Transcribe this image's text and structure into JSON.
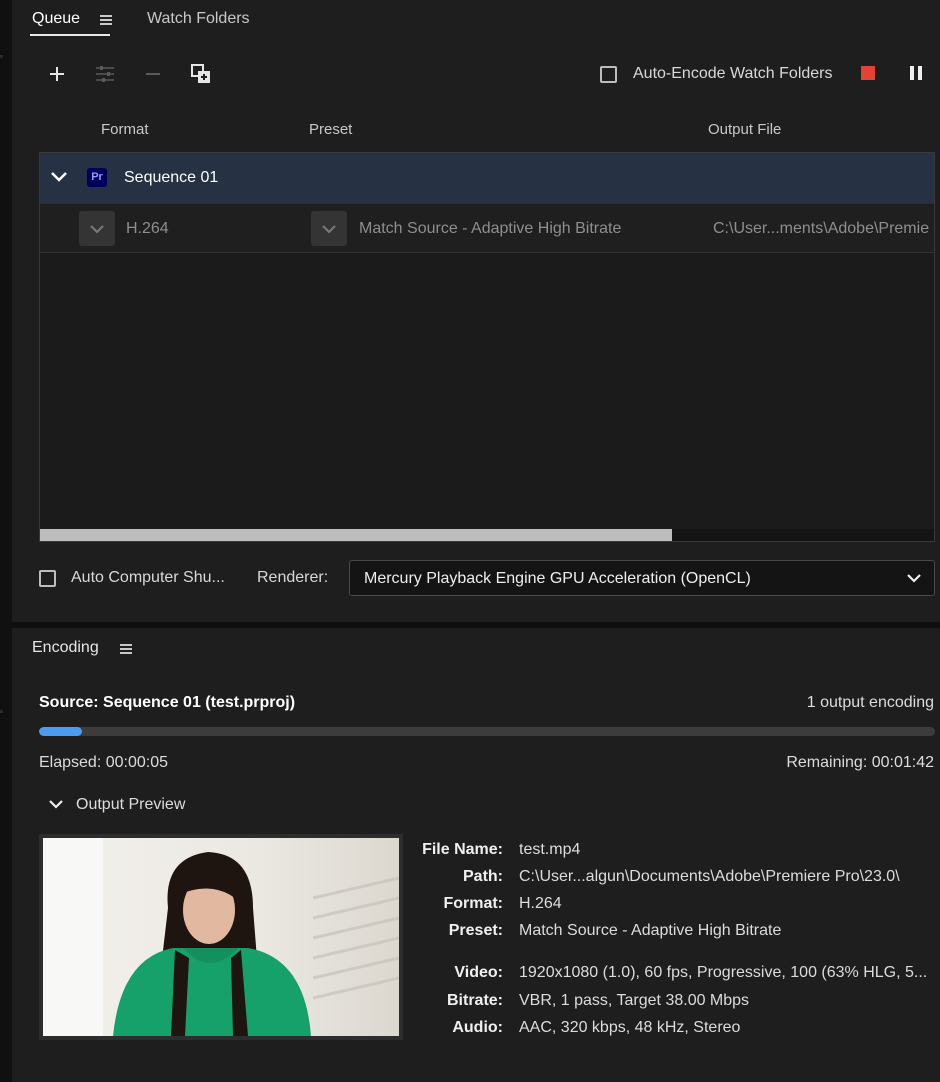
{
  "tabs": {
    "queue": "Queue",
    "watch_folders": "Watch Folders"
  },
  "toolbar": {
    "auto_encode_label": "Auto-Encode Watch Folders",
    "auto_encode_checked": false,
    "stop_color": "#e34234"
  },
  "columns": {
    "format": "Format",
    "preset": "Preset",
    "output": "Output File"
  },
  "queue": {
    "sequence_name": "Sequence 01",
    "app_badge": "Pr",
    "output": {
      "format": "H.264",
      "preset": "Match Source - Adaptive High Bitrate",
      "output_file": "C:\\User...ments\\Adobe\\Premie"
    }
  },
  "bottom_bar": {
    "auto_shutdown_label": "Auto Computer Shu...",
    "renderer_label": "Renderer:",
    "renderer_value": "Mercury Playback Engine GPU Acceleration (OpenCL)"
  },
  "encoding": {
    "title": "Encoding",
    "source": "Source: Sequence 01 (test.prproj)",
    "count": "1 output encoding",
    "progress_percent": 4.8,
    "elapsed": "Elapsed: 00:00:05",
    "remaining": "Remaining: 00:01:42",
    "preview_label": "Output Preview"
  },
  "info": [
    {
      "key": "File Name:",
      "value": "test.mp4"
    },
    {
      "key": "Path:",
      "value": "C:\\User...algun\\Documents\\Adobe\\Premiere Pro\\23.0\\"
    },
    {
      "key": "Format:",
      "value": "H.264"
    },
    {
      "key": "Preset:",
      "value": "Match Source - Adaptive High Bitrate"
    },
    {
      "key": "Video:",
      "value": "1920x1080 (1.0), 60 fps, Progressive, 100 (63% HLG, 5..."
    },
    {
      "key": "Bitrate:",
      "value": "VBR, 1 pass, Target 38.00 Mbps"
    },
    {
      "key": "Audio:",
      "value": "AAC, 320 kbps, 48 kHz, Stereo"
    }
  ]
}
